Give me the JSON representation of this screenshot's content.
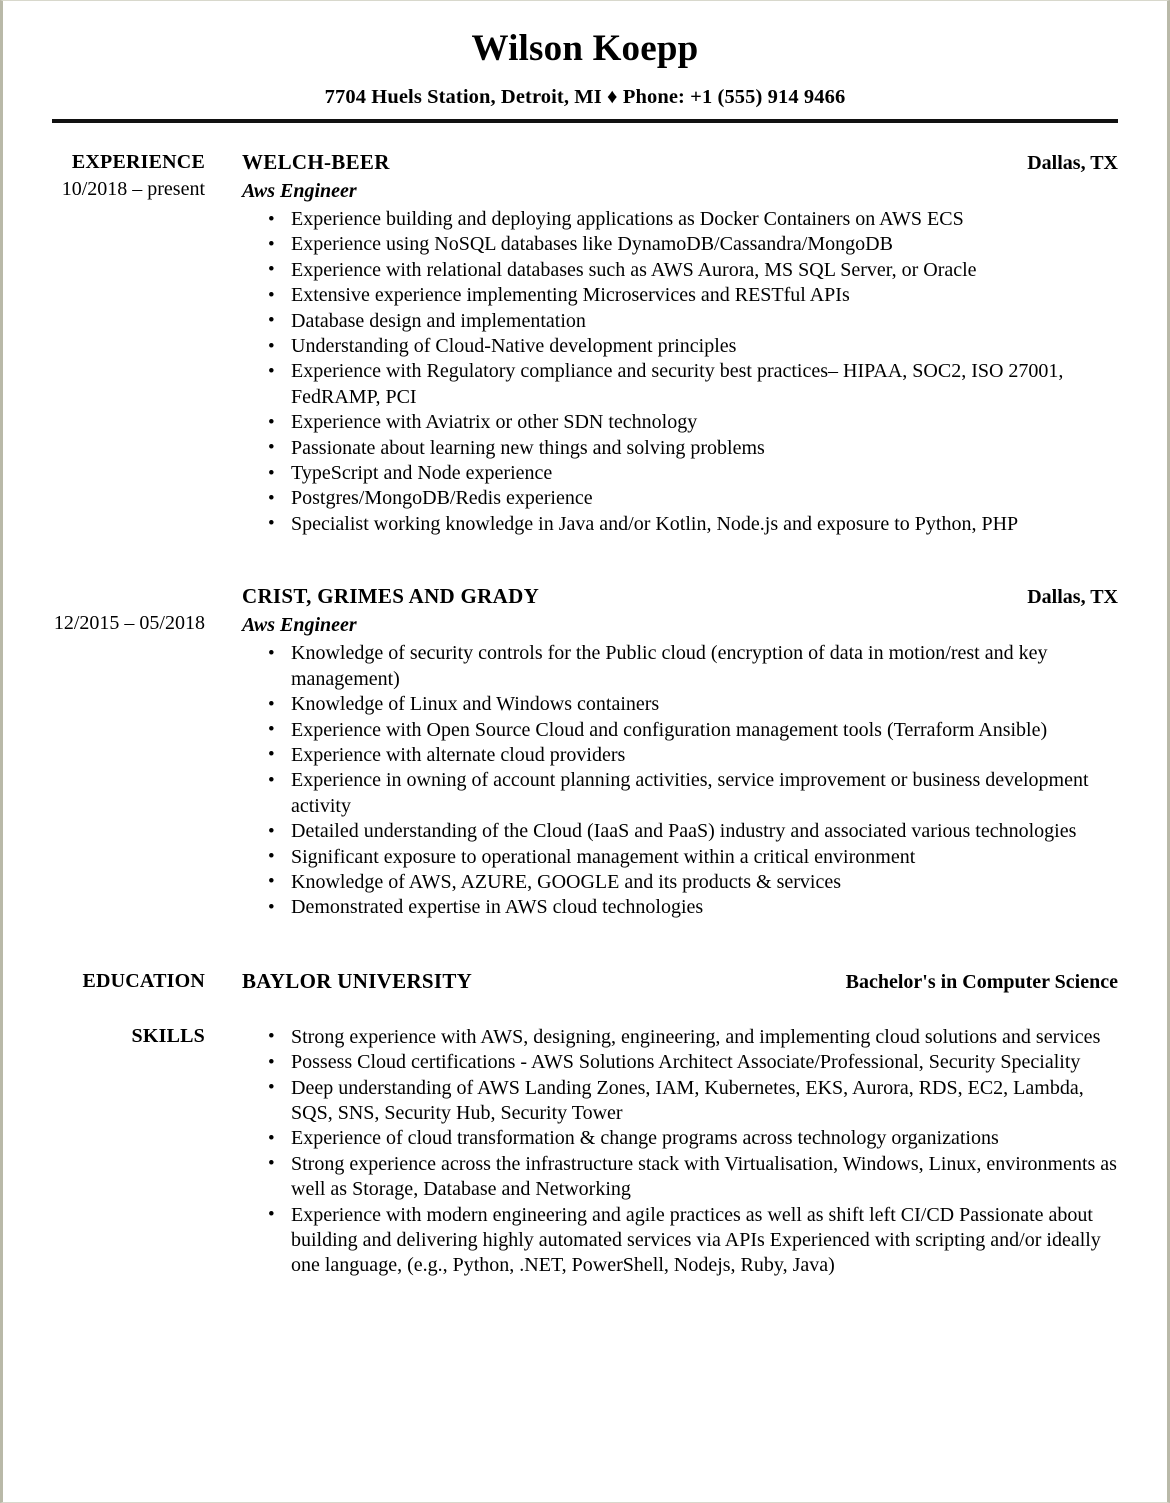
{
  "header": {
    "name": "Wilson Koepp",
    "contact": "7704 Huels Station, Detroit, MI ♦ Phone: +1 (555) 914 9466"
  },
  "experience": {
    "label": "EXPERIENCE",
    "jobs": [
      {
        "company": "WELCH-BEER",
        "location": "Dallas, TX",
        "title": "Aws Engineer",
        "dates": "10/2018 – present",
        "bullets": [
          "Experience building and deploying applications as Docker Containers on AWS ECS",
          "Experience using NoSQL databases like DynamoDB/Cassandra/MongoDB",
          "Experience with relational databases such as AWS Aurora, MS SQL Server, or Oracle",
          "Extensive experience implementing Microservices and RESTful APIs",
          "Database design and implementation",
          "Understanding of Cloud-Native development principles",
          "Experience with Regulatory compliance and security best practices– HIPAA, SOC2, ISO 27001, FedRAMP, PCI",
          "Experience with Aviatrix or other SDN technology",
          "Passionate about learning new things and solving problems",
          "TypeScript and Node experience",
          "Postgres/MongoDB/Redis experience",
          "Specialist working knowledge in Java and/or Kotlin, Node.js and exposure to Python, PHP"
        ]
      },
      {
        "company": "CRIST, GRIMES AND GRADY",
        "location": "Dallas, TX",
        "title": "Aws Engineer",
        "dates": "12/2015 – 05/2018",
        "bullets": [
          "Knowledge of security controls for the Public cloud (encryption of data in motion/rest and key management)",
          "Knowledge of Linux and Windows containers",
          "Experience with Open Source Cloud and configuration management tools (Terraform Ansible)",
          "Experience with alternate cloud providers",
          "Experience in owning of account planning activities, service improvement or business development activity",
          "Detailed understanding of the Cloud (IaaS and PaaS) industry and associated various technologies",
          "Significant exposure to operational management within a critical environment",
          "Knowledge of AWS, AZURE, GOOGLE and its products & services",
          "Demonstrated expertise in AWS cloud technologies"
        ]
      }
    ]
  },
  "education": {
    "label": "EDUCATION",
    "school": "BAYLOR UNIVERSITY",
    "degree": "Bachelor's in Computer Science"
  },
  "skills": {
    "label": "SKILLS",
    "bullets": [
      "Strong experience with AWS, designing, engineering, and implementing cloud solutions and services",
      "Possess Cloud certifications - AWS Solutions Architect Associate/Professional, Security Speciality",
      "Deep understanding of AWS Landing Zones, IAM, Kubernetes, EKS, Aurora, RDS, EC2, Lambda, SQS, SNS, Security Hub, Security Tower",
      "Experience of cloud transformation & change programs across technology organizations",
      "Strong experience across the infrastructure stack with Virtualisation, Windows, Linux, environments as well as Storage, Database and Networking",
      "Experience with modern engineering and agile practices as well as shift left CI/CD Passionate about building and delivering highly automated services via APIs Experienced with scripting and/or ideally one language, (e.g., Python, .NET, PowerShell, Nodejs, Ruby, Java)"
    ]
  }
}
